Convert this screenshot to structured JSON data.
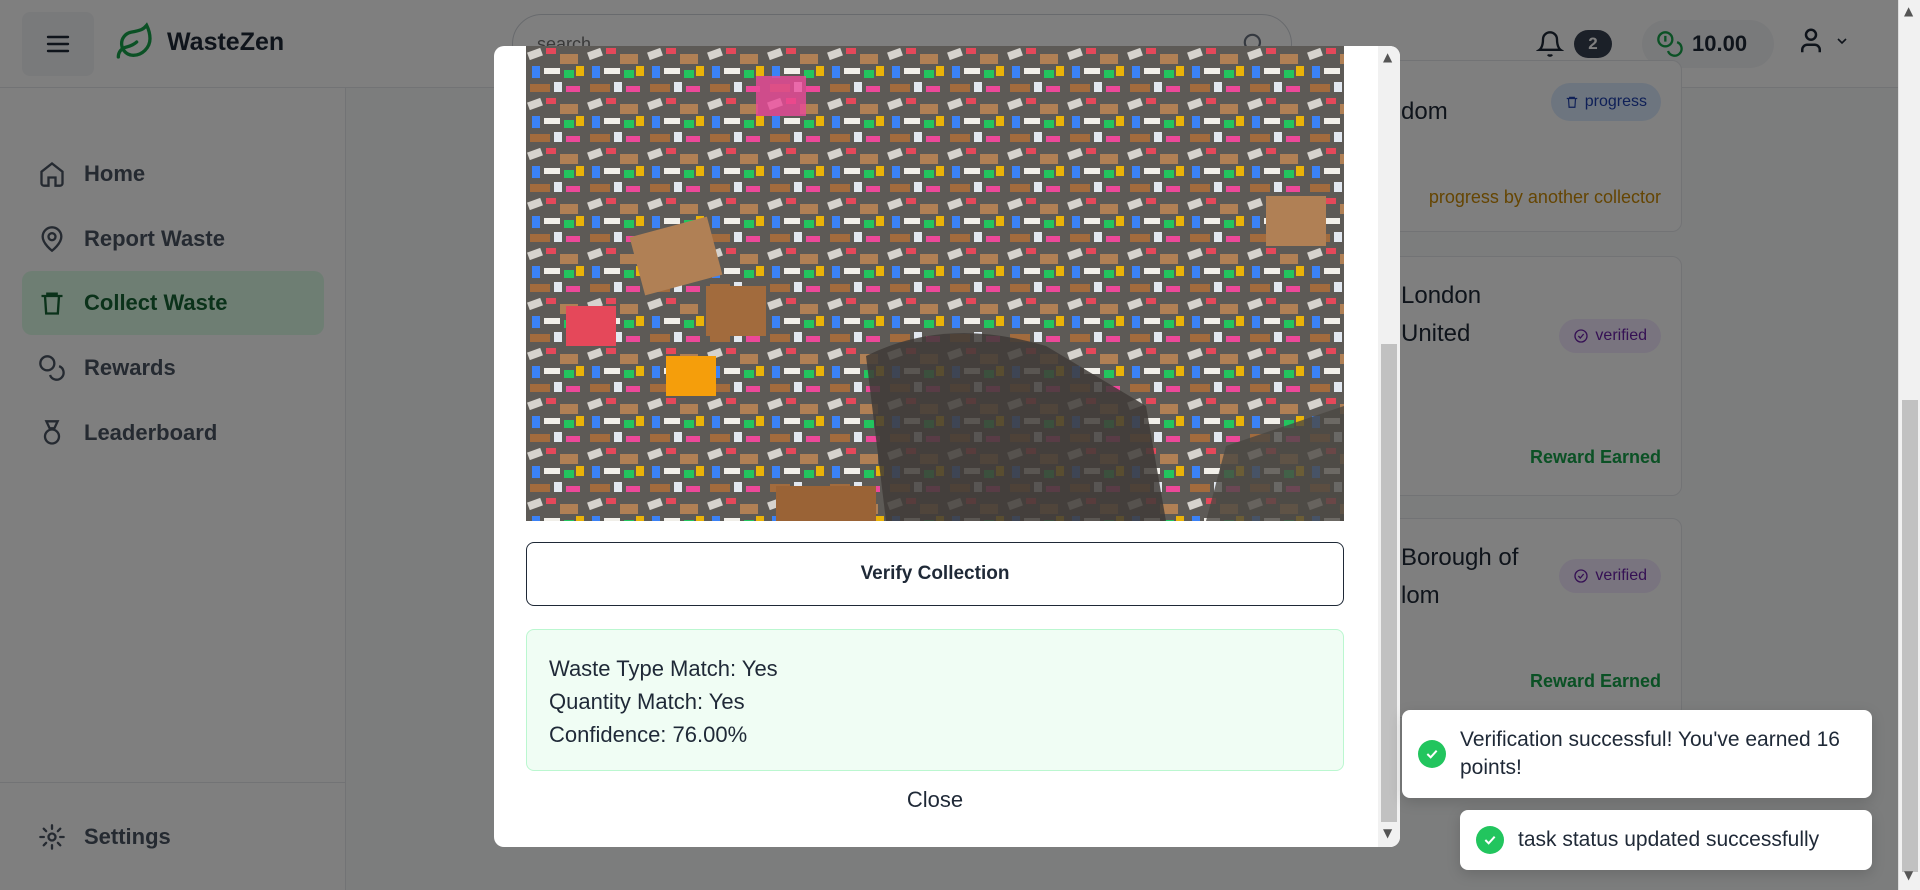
{
  "app": {
    "name": "WasteZen"
  },
  "search": {
    "placeholder": "search"
  },
  "header": {
    "notification_count": "2",
    "balance": "10.00"
  },
  "sidebar": {
    "items": [
      {
        "label": "Home",
        "icon": "home-icon"
      },
      {
        "label": "Report Waste",
        "icon": "map-pin-icon"
      },
      {
        "label": "Collect Waste",
        "icon": "trash-icon",
        "active": true
      },
      {
        "label": "Rewards",
        "icon": "coins-icon"
      },
      {
        "label": "Leaderboard",
        "icon": "medal-icon"
      }
    ],
    "settings_label": "Settings"
  },
  "tasks": [
    {
      "location": "dom",
      "status": "progress",
      "footer": "progress by another collector",
      "footer_color": "#ca8a04"
    },
    {
      "location_line1": "London",
      "location_line2": "United",
      "status": "verified",
      "footer": "Reward Earned",
      "footer_color": "#16a34a"
    },
    {
      "location_line1": "Borough of",
      "location_line2": "lom",
      "status": "verified",
      "footer": "Reward Earned",
      "footer_color": "#16a34a"
    }
  ],
  "modal": {
    "verify_button": "Verify Collection",
    "results": [
      "Waste Type Match: Yes",
      "Quantity Match: Yes",
      "Confidence: 76.00%"
    ],
    "close_button": "Close"
  },
  "toasts": [
    {
      "message": "Verification successful! You've earned 16 points!"
    },
    {
      "message": "task status updated successfully"
    }
  ],
  "colors": {
    "brand": "#16a34a",
    "active_bg": "#dcfce7",
    "success": "#22c55e"
  }
}
